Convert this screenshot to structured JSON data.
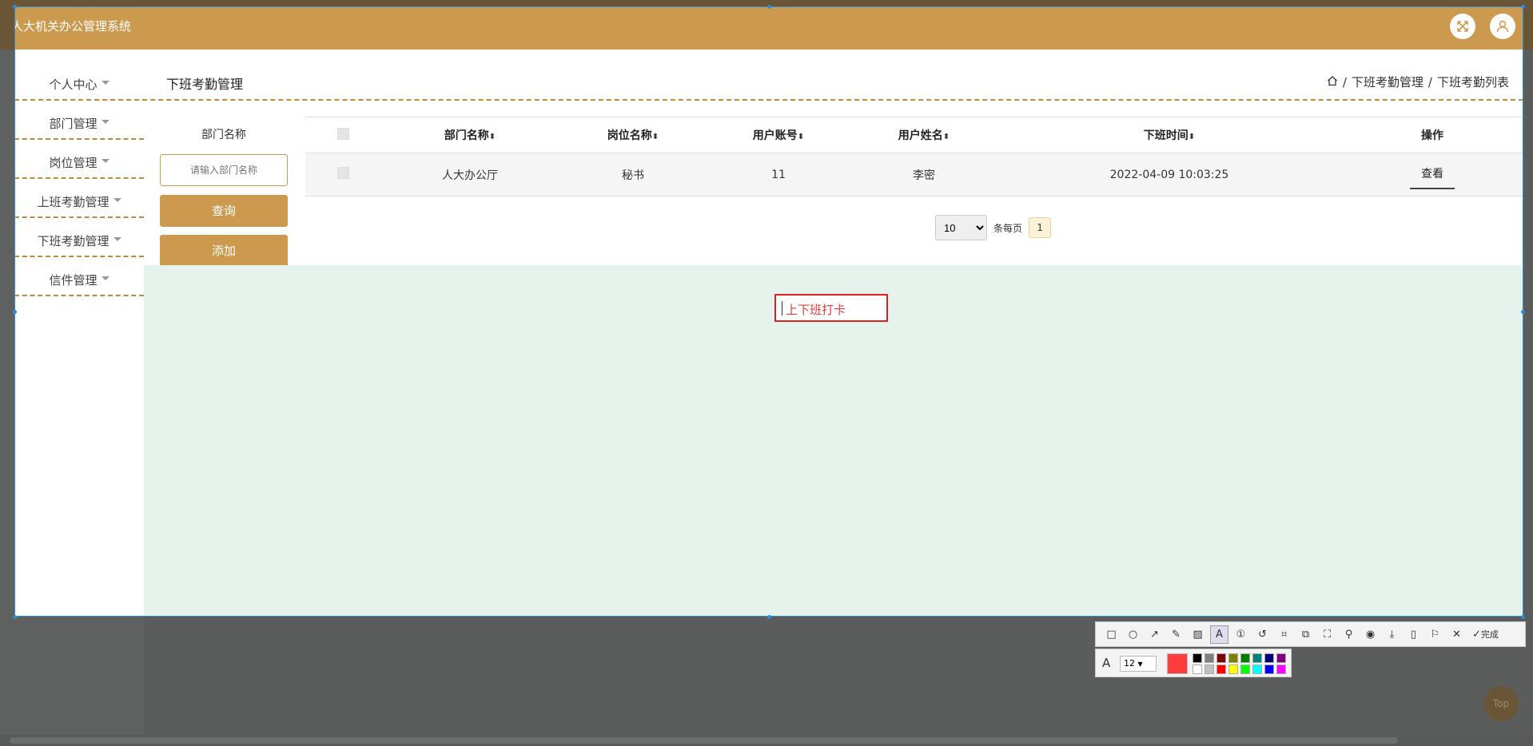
{
  "app": {
    "title": "人大机关办公管理系统"
  },
  "sidebar": {
    "items": [
      {
        "label": "个人中心"
      },
      {
        "label": "部门管理"
      },
      {
        "label": "岗位管理"
      },
      {
        "label": "上班考勤管理"
      },
      {
        "label": "下班考勤管理"
      },
      {
        "label": "信件管理"
      }
    ]
  },
  "page": {
    "title": "下班考勤管理",
    "breadcrumb": [
      "下班考勤管理",
      "下班考勤列表"
    ],
    "separator": "/"
  },
  "filter": {
    "label": "部门名称",
    "placeholder": "请输入部门名称",
    "search_label": "查询",
    "add_label": "添加"
  },
  "table": {
    "headers": [
      "部门名称",
      "岗位名称",
      "用户账号",
      "用户姓名",
      "下班时间",
      "操作"
    ],
    "rows": [
      {
        "department": "人大办公厅",
        "position": "秘书",
        "account": "11",
        "name": "李密",
        "time": "2022-04-09 10:03:25",
        "action": "查看"
      }
    ]
  },
  "pagination": {
    "page_size": "10",
    "per_page_label": "条每页",
    "current_page": "1"
  },
  "annotation": {
    "text": "上下班打卡",
    "color": "#e04040"
  },
  "screenshot_tool": {
    "done_label": "完成",
    "font_size": "12",
    "current_color": "#ff3b3b",
    "palette": [
      "#000000",
      "#808080",
      "#800000",
      "#808000",
      "#008000",
      "#008080",
      "#000080",
      "#800080",
      "#ffffff",
      "#c0c0c0",
      "#ff0000",
      "#ffff00",
      "#00ff00",
      "#00ffff",
      "#0000ff",
      "#ff00ff"
    ]
  },
  "scroll_top": {
    "label": "Top"
  },
  "colors": {
    "accent": "#cc9a4e",
    "main_bg": "#e6f2ec"
  }
}
